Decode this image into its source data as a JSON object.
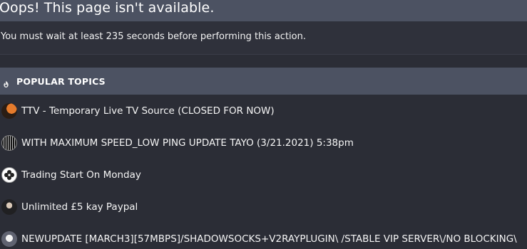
{
  "error": {
    "title": "Oops! This page isn't available.",
    "message": "You must wait at least 235 seconds before performing this action."
  },
  "popular_topics": {
    "title": "POPULAR TOPICS",
    "icon": "fire-icon",
    "items": [
      {
        "title": "TTV - Temporary Live TV Source (CLOSED FOR NOW)",
        "avatar": "orange-dark-avatar"
      },
      {
        "title": "WITH MAXIMUM SPEED_LOW PING UPDATE TAYO (3/21.2021) 5:38pm",
        "avatar": "striped-gray-avatar"
      },
      {
        "title": "Trading Start On Monday",
        "avatar": "white-clover-avatar"
      },
      {
        "title": "Unlimited £5 kay Paypal",
        "avatar": "character-avatar"
      },
      {
        "title": "NEWUPDATE [MARCH3][57MBPS]/SHADOWSOCKS+V2RAYPLUGIN\\ /STABLE VIP SERVER\\/NO BLOCKING\\",
        "avatar": "person-avatar"
      }
    ]
  },
  "colors": {
    "background": "#2b2d36",
    "header_bar": "#4c5262",
    "message_bar": "#2f313b",
    "text": "#ffffff"
  }
}
